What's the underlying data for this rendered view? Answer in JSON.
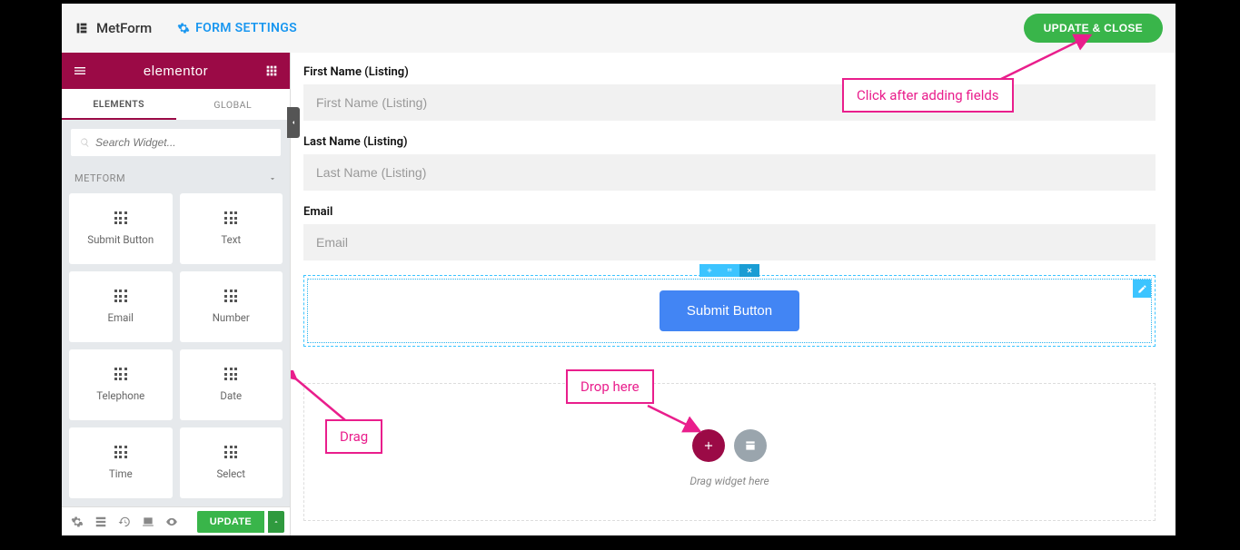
{
  "header": {
    "app_name": "MetForm",
    "form_settings_label": "FORM SETTINGS",
    "update_close_label": "UPDATE & CLOSE"
  },
  "sidebar": {
    "brand_text": "elementor",
    "tabs": {
      "elements": "ELEMENTS",
      "global": "GLOBAL"
    },
    "search_placeholder": "Search Widget...",
    "category_label": "METFORM",
    "widgets": [
      {
        "label": "Submit Button"
      },
      {
        "label": "Text"
      },
      {
        "label": "Email"
      },
      {
        "label": "Number"
      },
      {
        "label": "Telephone"
      },
      {
        "label": "Date"
      },
      {
        "label": "Time"
      },
      {
        "label": "Select"
      }
    ],
    "footer_update_label": "UPDATE"
  },
  "canvas": {
    "fields": [
      {
        "label": "First Name (Listing)",
        "placeholder": "First Name (Listing)"
      },
      {
        "label": "Last Name (Listing)",
        "placeholder": "Last Name (Listing)"
      },
      {
        "label": "Email",
        "placeholder": "Email"
      }
    ],
    "submit_label": "Submit Button",
    "drop_hint": "Drag widget here"
  },
  "callouts": {
    "drag": "Drag",
    "drop": "Drop here",
    "click_after": "Click after adding fields"
  }
}
